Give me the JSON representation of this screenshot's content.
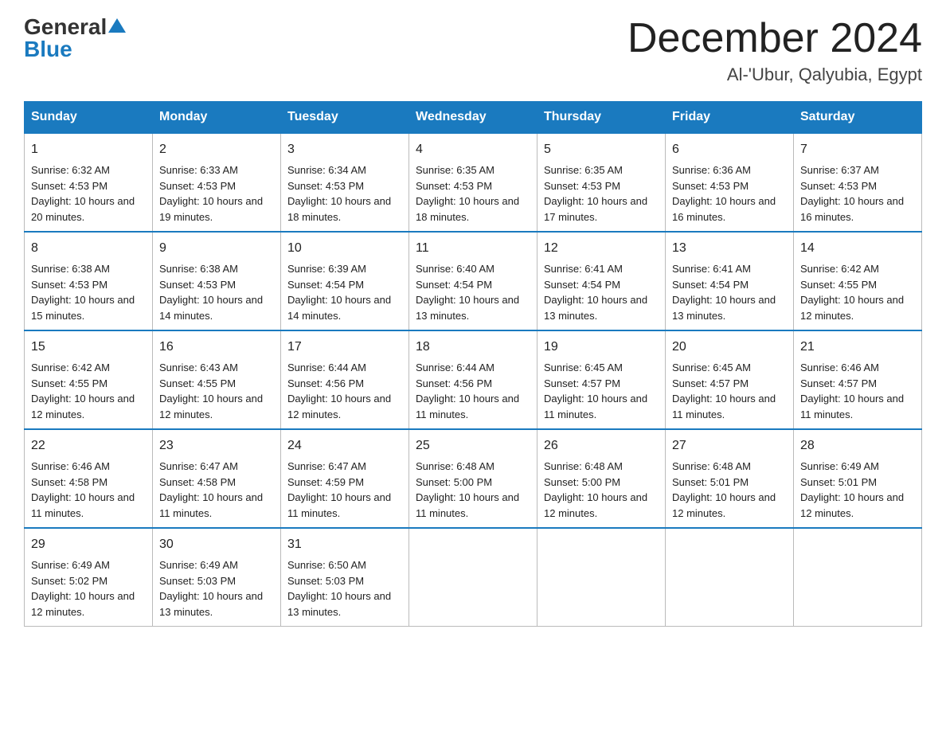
{
  "logo": {
    "general": "General",
    "blue": "Blue"
  },
  "title": "December 2024",
  "location": "Al-'Ubur, Qalyubia, Egypt",
  "days_of_week": [
    "Sunday",
    "Monday",
    "Tuesday",
    "Wednesday",
    "Thursday",
    "Friday",
    "Saturday"
  ],
  "weeks": [
    [
      {
        "day": "1",
        "sunrise": "6:32 AM",
        "sunset": "4:53 PM",
        "daylight": "10 hours and 20 minutes."
      },
      {
        "day": "2",
        "sunrise": "6:33 AM",
        "sunset": "4:53 PM",
        "daylight": "10 hours and 19 minutes."
      },
      {
        "day": "3",
        "sunrise": "6:34 AM",
        "sunset": "4:53 PM",
        "daylight": "10 hours and 18 minutes."
      },
      {
        "day": "4",
        "sunrise": "6:35 AM",
        "sunset": "4:53 PM",
        "daylight": "10 hours and 18 minutes."
      },
      {
        "day": "5",
        "sunrise": "6:35 AM",
        "sunset": "4:53 PM",
        "daylight": "10 hours and 17 minutes."
      },
      {
        "day": "6",
        "sunrise": "6:36 AM",
        "sunset": "4:53 PM",
        "daylight": "10 hours and 16 minutes."
      },
      {
        "day": "7",
        "sunrise": "6:37 AM",
        "sunset": "4:53 PM",
        "daylight": "10 hours and 16 minutes."
      }
    ],
    [
      {
        "day": "8",
        "sunrise": "6:38 AM",
        "sunset": "4:53 PM",
        "daylight": "10 hours and 15 minutes."
      },
      {
        "day": "9",
        "sunrise": "6:38 AM",
        "sunset": "4:53 PM",
        "daylight": "10 hours and 14 minutes."
      },
      {
        "day": "10",
        "sunrise": "6:39 AM",
        "sunset": "4:54 PM",
        "daylight": "10 hours and 14 minutes."
      },
      {
        "day": "11",
        "sunrise": "6:40 AM",
        "sunset": "4:54 PM",
        "daylight": "10 hours and 13 minutes."
      },
      {
        "day": "12",
        "sunrise": "6:41 AM",
        "sunset": "4:54 PM",
        "daylight": "10 hours and 13 minutes."
      },
      {
        "day": "13",
        "sunrise": "6:41 AM",
        "sunset": "4:54 PM",
        "daylight": "10 hours and 13 minutes."
      },
      {
        "day": "14",
        "sunrise": "6:42 AM",
        "sunset": "4:55 PM",
        "daylight": "10 hours and 12 minutes."
      }
    ],
    [
      {
        "day": "15",
        "sunrise": "6:42 AM",
        "sunset": "4:55 PM",
        "daylight": "10 hours and 12 minutes."
      },
      {
        "day": "16",
        "sunrise": "6:43 AM",
        "sunset": "4:55 PM",
        "daylight": "10 hours and 12 minutes."
      },
      {
        "day": "17",
        "sunrise": "6:44 AM",
        "sunset": "4:56 PM",
        "daylight": "10 hours and 12 minutes."
      },
      {
        "day": "18",
        "sunrise": "6:44 AM",
        "sunset": "4:56 PM",
        "daylight": "10 hours and 11 minutes."
      },
      {
        "day": "19",
        "sunrise": "6:45 AM",
        "sunset": "4:57 PM",
        "daylight": "10 hours and 11 minutes."
      },
      {
        "day": "20",
        "sunrise": "6:45 AM",
        "sunset": "4:57 PM",
        "daylight": "10 hours and 11 minutes."
      },
      {
        "day": "21",
        "sunrise": "6:46 AM",
        "sunset": "4:57 PM",
        "daylight": "10 hours and 11 minutes."
      }
    ],
    [
      {
        "day": "22",
        "sunrise": "6:46 AM",
        "sunset": "4:58 PM",
        "daylight": "10 hours and 11 minutes."
      },
      {
        "day": "23",
        "sunrise": "6:47 AM",
        "sunset": "4:58 PM",
        "daylight": "10 hours and 11 minutes."
      },
      {
        "day": "24",
        "sunrise": "6:47 AM",
        "sunset": "4:59 PM",
        "daylight": "10 hours and 11 minutes."
      },
      {
        "day": "25",
        "sunrise": "6:48 AM",
        "sunset": "5:00 PM",
        "daylight": "10 hours and 11 minutes."
      },
      {
        "day": "26",
        "sunrise": "6:48 AM",
        "sunset": "5:00 PM",
        "daylight": "10 hours and 12 minutes."
      },
      {
        "day": "27",
        "sunrise": "6:48 AM",
        "sunset": "5:01 PM",
        "daylight": "10 hours and 12 minutes."
      },
      {
        "day": "28",
        "sunrise": "6:49 AM",
        "sunset": "5:01 PM",
        "daylight": "10 hours and 12 minutes."
      }
    ],
    [
      {
        "day": "29",
        "sunrise": "6:49 AM",
        "sunset": "5:02 PM",
        "daylight": "10 hours and 12 minutes."
      },
      {
        "day": "30",
        "sunrise": "6:49 AM",
        "sunset": "5:03 PM",
        "daylight": "10 hours and 13 minutes."
      },
      {
        "day": "31",
        "sunrise": "6:50 AM",
        "sunset": "5:03 PM",
        "daylight": "10 hours and 13 minutes."
      },
      null,
      null,
      null,
      null
    ]
  ]
}
